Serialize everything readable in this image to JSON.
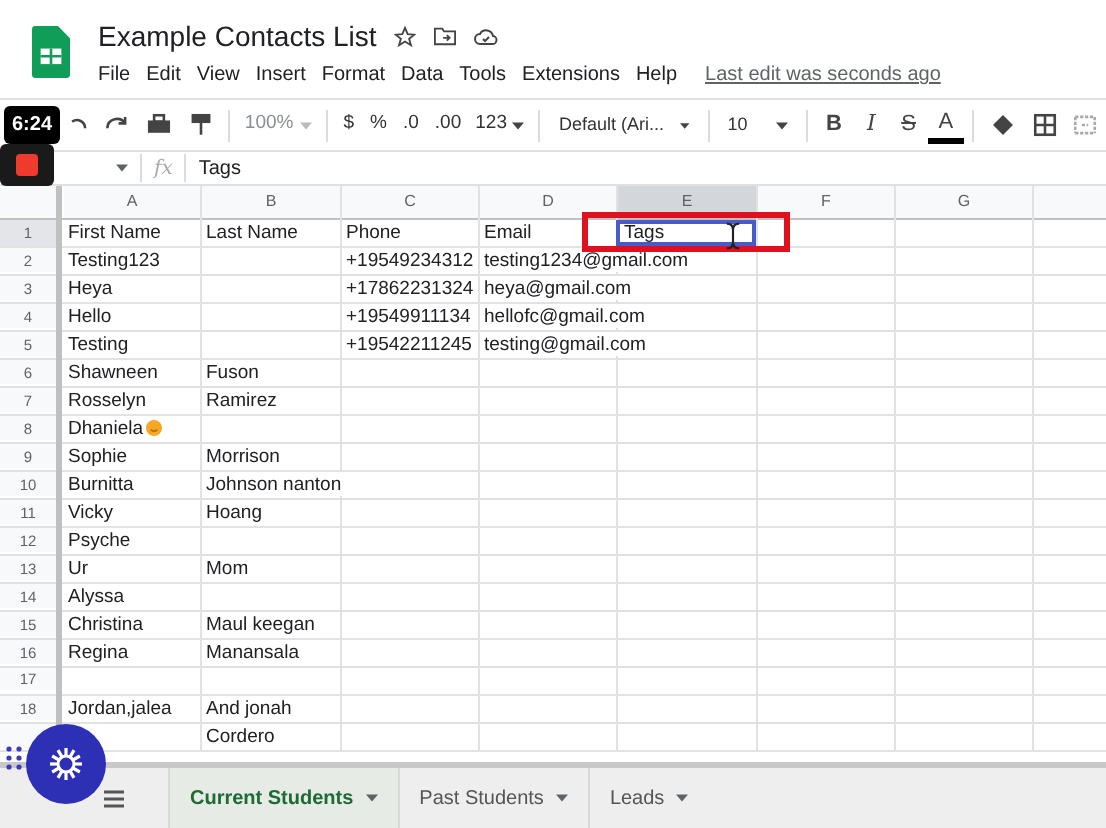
{
  "document": {
    "title": "Example Contacts List",
    "last_edit": "Last edit was seconds ago"
  },
  "menu": [
    "File",
    "Edit",
    "View",
    "Insert",
    "Format",
    "Data",
    "Tools",
    "Extensions",
    "Help"
  ],
  "toolbar": [
    {
      "kind": "undo"
    },
    {
      "kind": "redo"
    },
    {
      "kind": "print"
    },
    {
      "kind": "paint"
    },
    {
      "kind": "sep"
    },
    {
      "kind": "dropdown",
      "label": "100%",
      "disabled": true
    },
    {
      "kind": "sep"
    },
    {
      "kind": "text",
      "label": "$"
    },
    {
      "kind": "text",
      "label": "%"
    },
    {
      "kind": "text",
      "label": ".0"
    },
    {
      "kind": "text",
      "label": ".00"
    },
    {
      "kind": "dropdown",
      "label": "123",
      "disabled": false
    },
    {
      "kind": "sep"
    },
    {
      "kind": "wide",
      "label": "Default (Ari..."
    },
    {
      "kind": "sep"
    },
    {
      "kind": "wide",
      "label": "10"
    },
    {
      "kind": "sep"
    },
    {
      "kind": "bold",
      "label": "B"
    },
    {
      "kind": "italic",
      "label": "I"
    },
    {
      "kind": "strike",
      "label": "S"
    },
    {
      "kind": "color",
      "label": "A"
    },
    {
      "kind": "sep"
    },
    {
      "kind": "fill"
    },
    {
      "kind": "borders"
    },
    {
      "kind": "merge"
    }
  ],
  "recording": {
    "time": "6:24"
  },
  "formula_bar": {
    "fx": "fx",
    "value": "Tags"
  },
  "columns": [
    {
      "label": "A",
      "selected": false
    },
    {
      "label": "B",
      "selected": false
    },
    {
      "label": "C",
      "selected": false
    },
    {
      "label": "D",
      "selected": false
    },
    {
      "label": "E",
      "selected": true
    },
    {
      "label": "F",
      "selected": false
    },
    {
      "label": "G",
      "selected": false
    }
  ],
  "rows": [
    {
      "number": "1",
      "selected": true,
      "cells": [
        "First Name",
        "Last Name",
        "Phone",
        "Email",
        "Tags"
      ]
    },
    {
      "number": "2",
      "selected": false,
      "cells": [
        "Testing123",
        "",
        "+19549234312",
        "testing1234@gmail.com"
      ]
    },
    {
      "number": "3",
      "selected": false,
      "cells": [
        "Heya",
        "",
        "+17862231324",
        "heya@gmail.com"
      ]
    },
    {
      "number": "4",
      "selected": false,
      "cells": [
        "Hello",
        "",
        "+19549911134",
        "hellofc@gmail.com"
      ]
    },
    {
      "number": "5",
      "selected": false,
      "cells": [
        "Testing",
        "",
        "+19542211245",
        "testing@gmail.com"
      ]
    },
    {
      "number": "6",
      "selected": false,
      "cells": [
        "Shawneen",
        "Fuson"
      ]
    },
    {
      "number": "7",
      "selected": false,
      "cells": [
        "Rosselyn",
        "Ramirez"
      ]
    },
    {
      "number": "8",
      "selected": false,
      "cells": [
        "Dhaniela"
      ],
      "emoji": true
    },
    {
      "number": "9",
      "selected": false,
      "cells": [
        "Sophie",
        "Morrison"
      ]
    },
    {
      "number": "10",
      "selected": false,
      "cells": [
        "Burnitta",
        "Johnson nanton"
      ]
    },
    {
      "number": "11",
      "selected": false,
      "cells": [
        "Vicky",
        "Hoang"
      ]
    },
    {
      "number": "12",
      "selected": false,
      "cells": [
        "Psyche"
      ]
    },
    {
      "number": "13",
      "selected": false,
      "cells": [
        "Ur",
        "Mom"
      ]
    },
    {
      "number": "14",
      "selected": false,
      "cells": [
        "Alyssa"
      ]
    },
    {
      "number": "15",
      "selected": false,
      "cells": [
        "Christina",
        "Maul keegan"
      ]
    },
    {
      "number": "16",
      "selected": false,
      "cells": [
        "Regina",
        "Manansala"
      ]
    },
    {
      "number": "17",
      "selected": false,
      "cells": []
    },
    {
      "number": "18",
      "selected": false,
      "cells": [
        "Jordan,jalea",
        "And jonah"
      ]
    },
    {
      "selected": false,
      "cells": [
        "",
        "Cordero"
      ]
    }
  ],
  "sheets": [
    {
      "label": "Current Students",
      "selected": true
    },
    {
      "label": "Past Students",
      "selected": false
    },
    {
      "label": "Leads",
      "selected": false
    }
  ]
}
